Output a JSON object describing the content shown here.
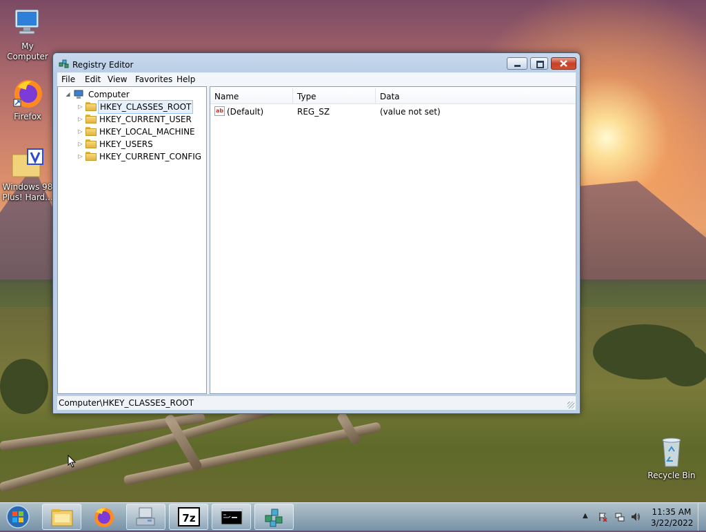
{
  "desktop": {
    "icons": [
      {
        "label": "My Computer"
      },
      {
        "label": "Firefox"
      },
      {
        "label": "Windows 98 Plus! Hard..."
      },
      {
        "label": "Recycle Bin"
      }
    ]
  },
  "window": {
    "title": "Registry Editor",
    "menu": [
      "File",
      "Edit",
      "View",
      "Favorites",
      "Help"
    ],
    "tree": {
      "root": "Computer",
      "keys": [
        "HKEY_CLASSES_ROOT",
        "HKEY_CURRENT_USER",
        "HKEY_LOCAL_MACHINE",
        "HKEY_USERS",
        "HKEY_CURRENT_CONFIG"
      ],
      "selected": "HKEY_CLASSES_ROOT"
    },
    "list": {
      "columns": [
        "Name",
        "Type",
        "Data"
      ],
      "rows": [
        {
          "name": "(Default)",
          "type": "REG_SZ",
          "data": "(value not set)"
        }
      ]
    },
    "status": "Computer\\HKEY_CLASSES_ROOT"
  },
  "taskbar": {
    "items": [
      "file-explorer",
      "firefox",
      "network-computer",
      "7-zip",
      "command-prompt",
      "registry-editor"
    ],
    "clock": {
      "time": "11:35 AM",
      "date": "3/22/2022"
    }
  },
  "colors": {
    "selection": "#e5f0fb",
    "selection_border": "#9cc3e9",
    "close_button": "#c7402a"
  }
}
